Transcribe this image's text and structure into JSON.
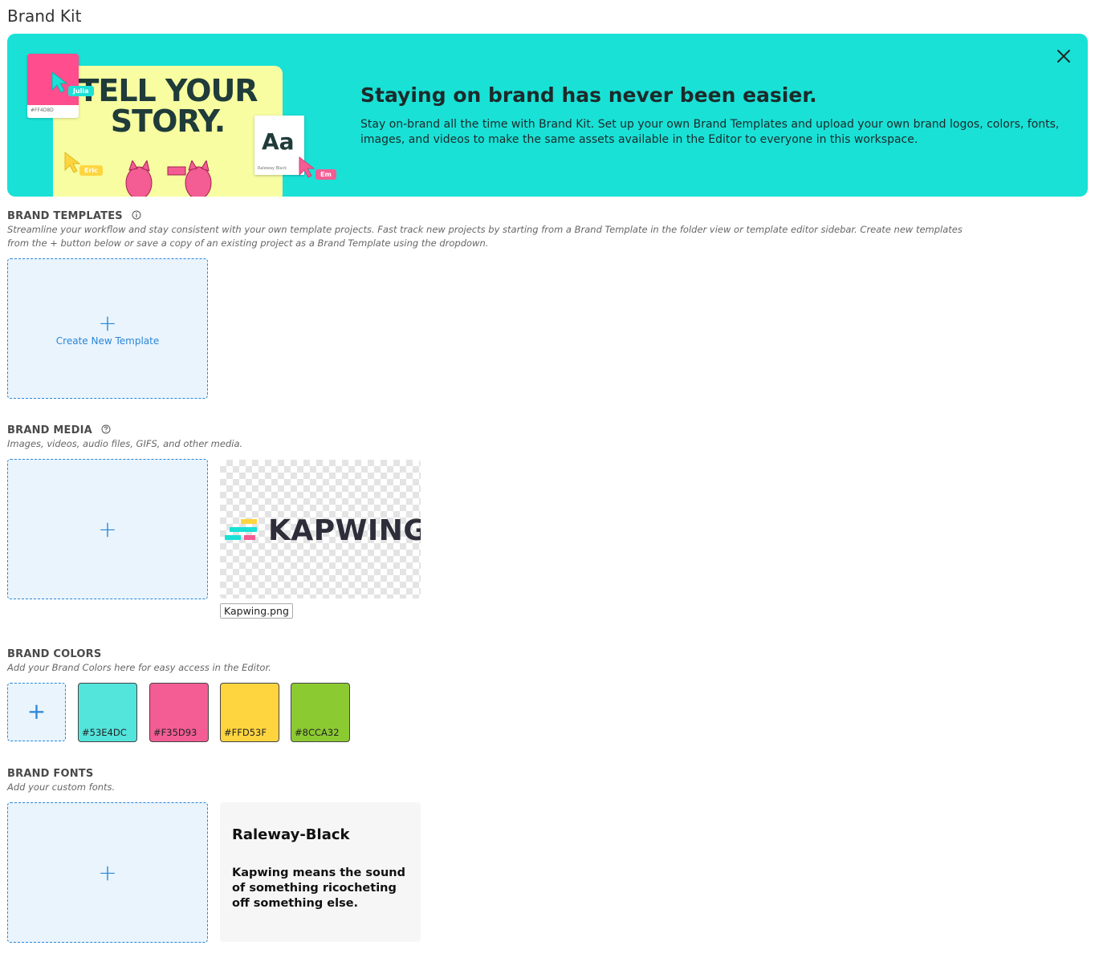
{
  "page": {
    "title": "Brand Kit"
  },
  "banner": {
    "heading": "Staying on brand has never been easier.",
    "body": "Stay on-brand all the time with Brand Kit. Set up your own Brand Templates and upload your own brand logos, colors, fonts, images, and videos to make the same assets available in the Editor to everyone in this workspace.",
    "art": {
      "headline": "TELL YOUR STORY.",
      "swatch_hex": "#FF4D8D",
      "aa": "Aa",
      "aa_font": "Raleway Black",
      "tags": [
        "Julia",
        "Eric",
        "Em"
      ]
    },
    "background": "#19E1D6",
    "close_icon": "close-icon"
  },
  "templates": {
    "title": "BRAND TEMPLATES",
    "description": "Streamline your workflow and stay consistent with your own template projects. Fast track new projects by starting from a Brand Template in the folder view or template editor sidebar. Create new templates from the + button below or save a copy of an existing project as a Brand Template using the dropdown.",
    "create_label": "Create New Template",
    "plus": "+"
  },
  "media": {
    "title": "BRAND MEDIA",
    "description": "Images, videos, audio files, GIFS, and other media.",
    "plus": "+",
    "items": [
      {
        "name": "Kapwing.png",
        "logo_text": "KAPWING"
      }
    ]
  },
  "colors": {
    "title": "BRAND COLORS",
    "description": "Add your Brand Colors here for easy access in the Editor.",
    "plus": "+",
    "items": [
      {
        "hex": "#53E4DC"
      },
      {
        "hex": "#F35D93"
      },
      {
        "hex": "#FFD53F"
      },
      {
        "hex": "#8CCA32"
      }
    ]
  },
  "fonts": {
    "title": "BRAND FONTS",
    "description": "Add your custom fonts.",
    "plus": "+",
    "items": [
      {
        "name": "Raleway-Black",
        "sample": "Kapwing means the sound of something ricocheting off something else."
      }
    ]
  }
}
